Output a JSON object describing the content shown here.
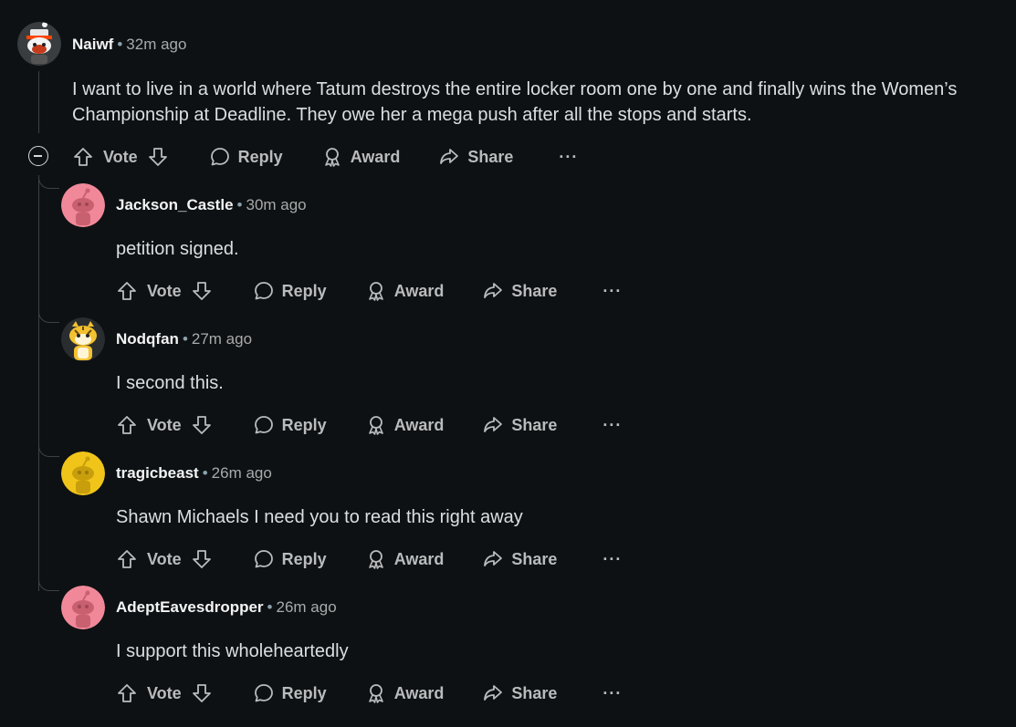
{
  "colors": {
    "background": "#0e1113",
    "text": "#d7dadc",
    "muted": "#a8aaab",
    "thread_line": "#3e4142"
  },
  "actions": {
    "vote_label": "Vote",
    "reply_label": "Reply",
    "award_label": "Award",
    "share_label": "Share",
    "more_label": "···"
  },
  "parent": {
    "author": "Naiwf",
    "time": "32m ago",
    "body_line1": "I want to live in a world where Tatum destroys the entire locker room one by one and finally wins the Women’s",
    "body_line2": "Championship at Deadline. They owe her a mega push after all the stops and starts."
  },
  "replies": [
    {
      "author": "Jackson_Castle",
      "time": "30m ago",
      "body": "petition signed."
    },
    {
      "author": "Nodqfan",
      "time": "27m ago",
      "body": "I second this."
    },
    {
      "author": "tragicbeast",
      "time": "26m ago",
      "body": "Shawn Michaels I need you to read this right away"
    },
    {
      "author": "AdeptEavesdropper",
      "time": "26m ago",
      "body": "I support this wholeheartedly"
    }
  ]
}
